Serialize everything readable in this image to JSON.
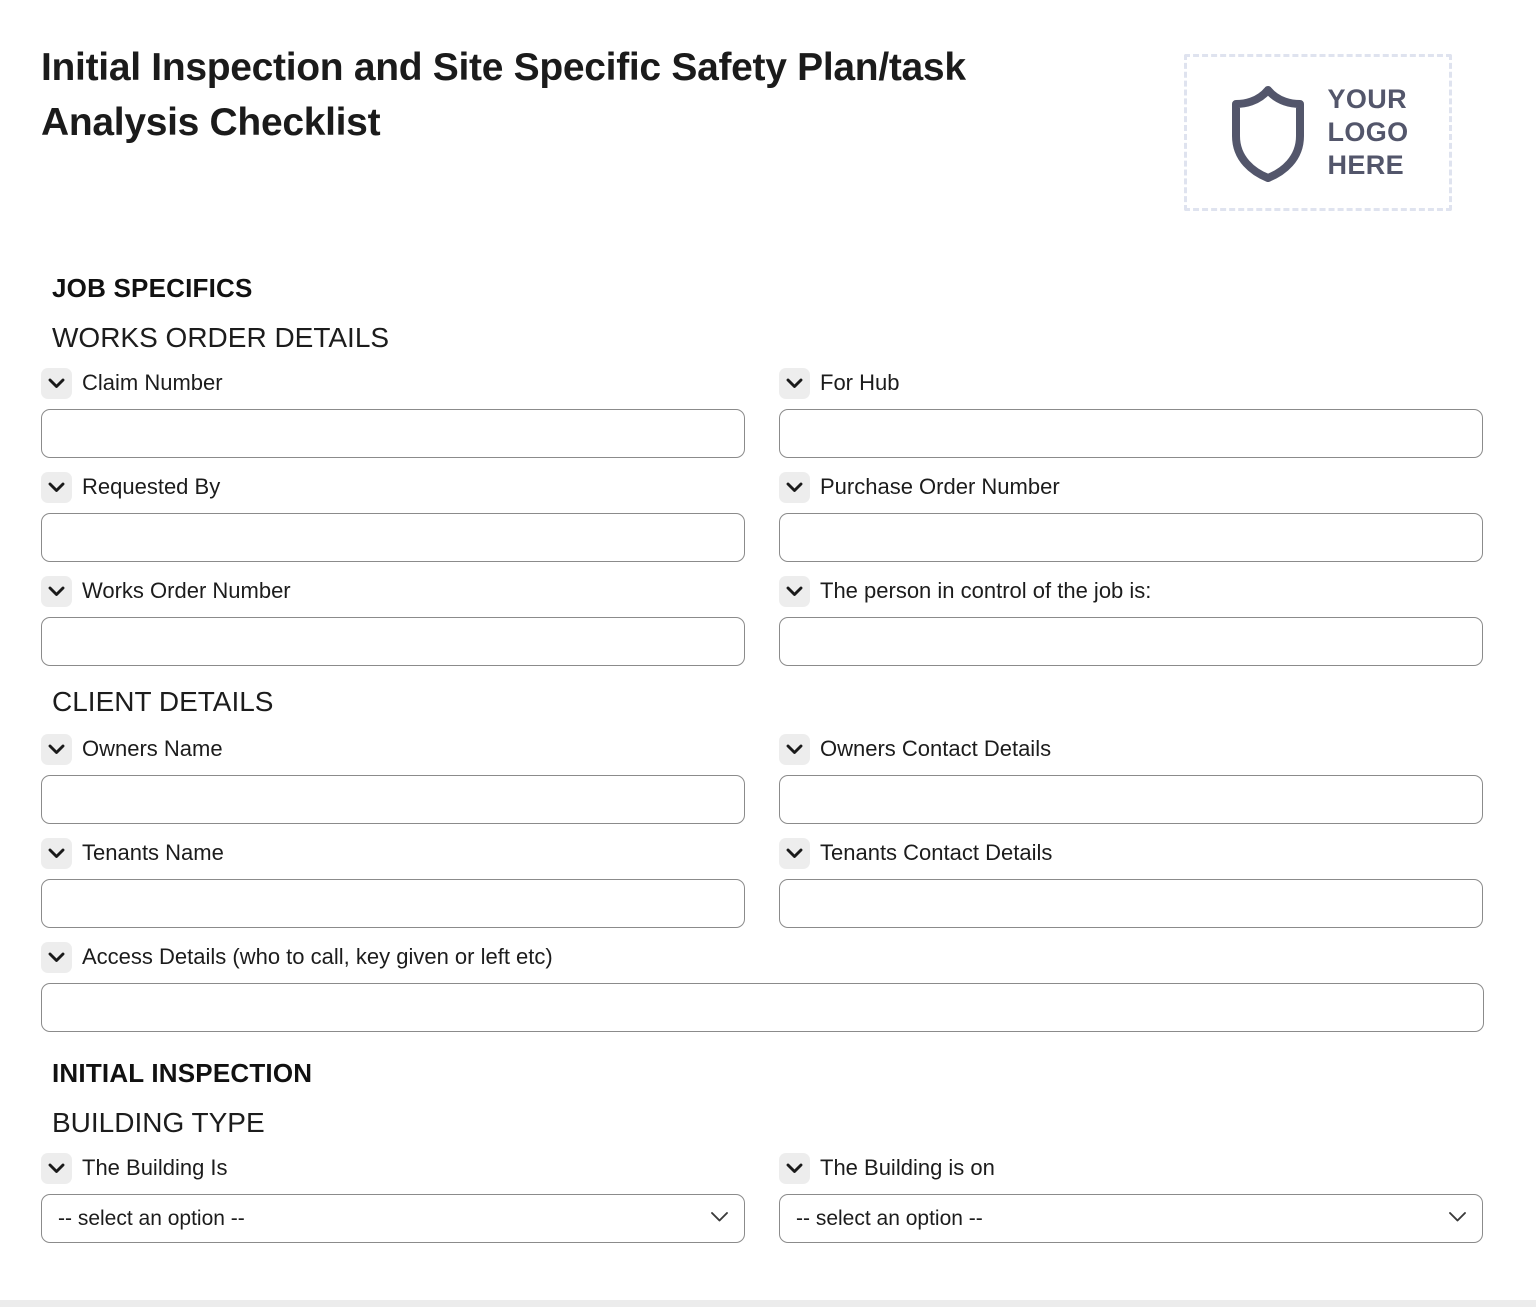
{
  "document": {
    "title": "Initial Inspection and Site Specific Safety Plan/task Analysis Checklist"
  },
  "logo": {
    "line1": "YOUR",
    "line2": "LOGO",
    "line3": "HERE",
    "icon": "shield-icon",
    "border_color": "#dfe3ef",
    "shield_color": "#53566b"
  },
  "sections": {
    "job_specifics": "JOB SPECIFICS",
    "works_order_details": "WORKS ORDER DETAILS",
    "client_details": "CLIENT DETAILS",
    "initial_inspection": "INITIAL INSPECTION",
    "building_type": "BUILDING TYPE"
  },
  "fields": {
    "claim_number": {
      "label": "Claim Number",
      "value": "",
      "placeholder": ""
    },
    "for_hub": {
      "label": "For Hub",
      "value": "",
      "placeholder": ""
    },
    "requested_by": {
      "label": "Requested By",
      "value": "",
      "placeholder": ""
    },
    "purchase_order": {
      "label": "Purchase Order Number",
      "value": "",
      "placeholder": ""
    },
    "works_order_number": {
      "label": "Works Order Number",
      "value": "",
      "placeholder": ""
    },
    "person_in_control": {
      "label": "The person in control of the job is:",
      "value": "",
      "placeholder": ""
    },
    "owners_name": {
      "label": "Owners Name",
      "value": "",
      "placeholder": ""
    },
    "owners_contact": {
      "label": "Owners Contact Details",
      "value": "",
      "placeholder": ""
    },
    "tenants_name": {
      "label": "Tenants Name",
      "value": "",
      "placeholder": ""
    },
    "tenants_contact": {
      "label": "Tenants Contact Details",
      "value": "",
      "placeholder": ""
    },
    "access_details": {
      "label": "Access Details (who to call, key given or left etc)",
      "value": "",
      "placeholder": ""
    },
    "building_is": {
      "label": "The Building Is",
      "selected": "-- select an option --"
    },
    "building_is_on": {
      "label": "The Building is on",
      "selected": "-- select an option --"
    }
  },
  "icons": {
    "chevron": "chevron-down-icon",
    "select_caret": "chevron-down-icon"
  }
}
